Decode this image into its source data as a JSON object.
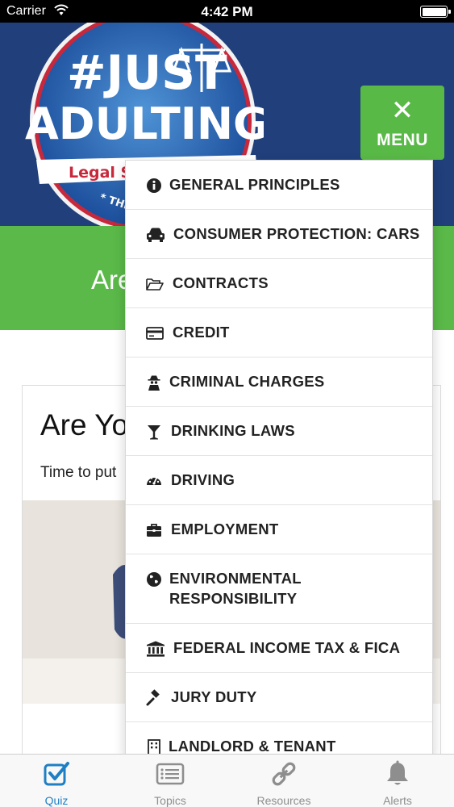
{
  "status_bar": {
    "carrier": "Carrier",
    "time": "4:42 PM"
  },
  "header": {
    "logo": {
      "line1": "#JUST",
      "line2": "ADULTING",
      "ribbon": "Legal S",
      "ring_text": "* THE F"
    },
    "menu_button": {
      "icon": "close-icon",
      "label": "MENU"
    }
  },
  "banner": {
    "title_partial": "Are"
  },
  "card": {
    "title_partial": "Are Yo",
    "text_partial": "Time to put"
  },
  "menu": {
    "items": [
      {
        "label": "GENERAL PRINCIPLES",
        "icon": "info-circle-icon"
      },
      {
        "label": "CONSUMER PROTECTION: CARS",
        "icon": "car-icon"
      },
      {
        "label": "CONTRACTS",
        "icon": "folder-open-icon"
      },
      {
        "label": "CREDIT",
        "icon": "credit-card-icon"
      },
      {
        "label": "CRIMINAL CHARGES",
        "icon": "user-secret-icon"
      },
      {
        "label": "DRINKING LAWS",
        "icon": "cocktail-glass-icon"
      },
      {
        "label": "DRIVING",
        "icon": "dashboard-icon"
      },
      {
        "label": "EMPLOYMENT",
        "icon": "briefcase-icon"
      },
      {
        "label": "ENVIRONMENTAL RESPONSIBILITY",
        "icon": "globe-icon"
      },
      {
        "label": "FEDERAL INCOME TAX & FICA",
        "icon": "bank-icon"
      },
      {
        "label": "JURY DUTY",
        "icon": "gavel-icon"
      },
      {
        "label": "LANDLORD & TENANT",
        "icon": "building-icon"
      }
    ]
  },
  "tabbar": {
    "tabs": [
      {
        "label": "Quiz",
        "icon": "checkbox-icon",
        "active": true
      },
      {
        "label": "Topics",
        "icon": "list-icon",
        "active": false
      },
      {
        "label": "Resources",
        "icon": "link-icon",
        "active": false
      },
      {
        "label": "Alerts",
        "icon": "bell-icon",
        "active": false
      }
    ]
  },
  "colors": {
    "header_blue": "#203f7b",
    "accent_green": "#59b947",
    "tab_active_blue": "#1e7fc4"
  }
}
